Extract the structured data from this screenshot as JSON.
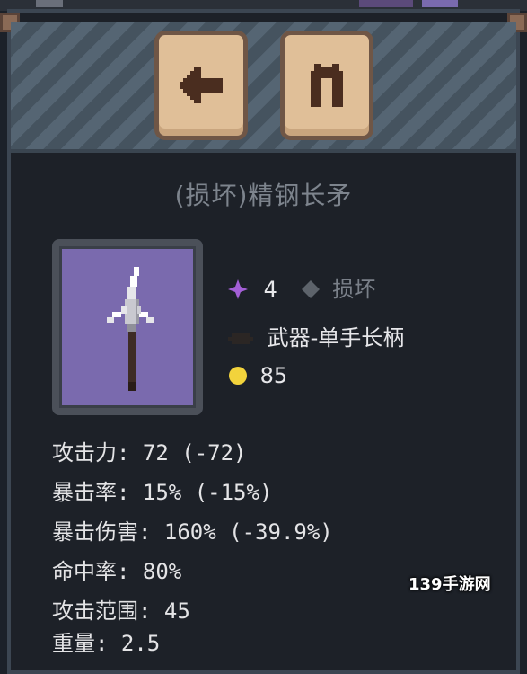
{
  "header": {
    "back_icon": "arrow-left-icon",
    "equip_icon": "armor-icon"
  },
  "item": {
    "name": "(损坏)精钢长矛",
    "image": "spear-icon",
    "level": "4",
    "condition": "损坏",
    "type": "武器-单手长柄",
    "price": "85"
  },
  "stats": [
    {
      "label": "攻击力:",
      "value": " 72 (-72)"
    },
    {
      "label": "暴击率:",
      "value": " 15% (-15%)"
    },
    {
      "label": "暴击伤害:",
      "value": " 160% (-39.9%)"
    },
    {
      "label": "命中率:",
      "value": " 80%"
    },
    {
      "label": "攻击范围:",
      "value": " 45"
    },
    {
      "label": "重量:",
      "value": " 2.5"
    }
  ],
  "watermark": "139手游网",
  "colors": {
    "background": "#1d2128",
    "button": "#e0bf98",
    "item_bg": "#7a6aae",
    "level_star": "#a35fd6",
    "coin": "#f2d33c"
  }
}
